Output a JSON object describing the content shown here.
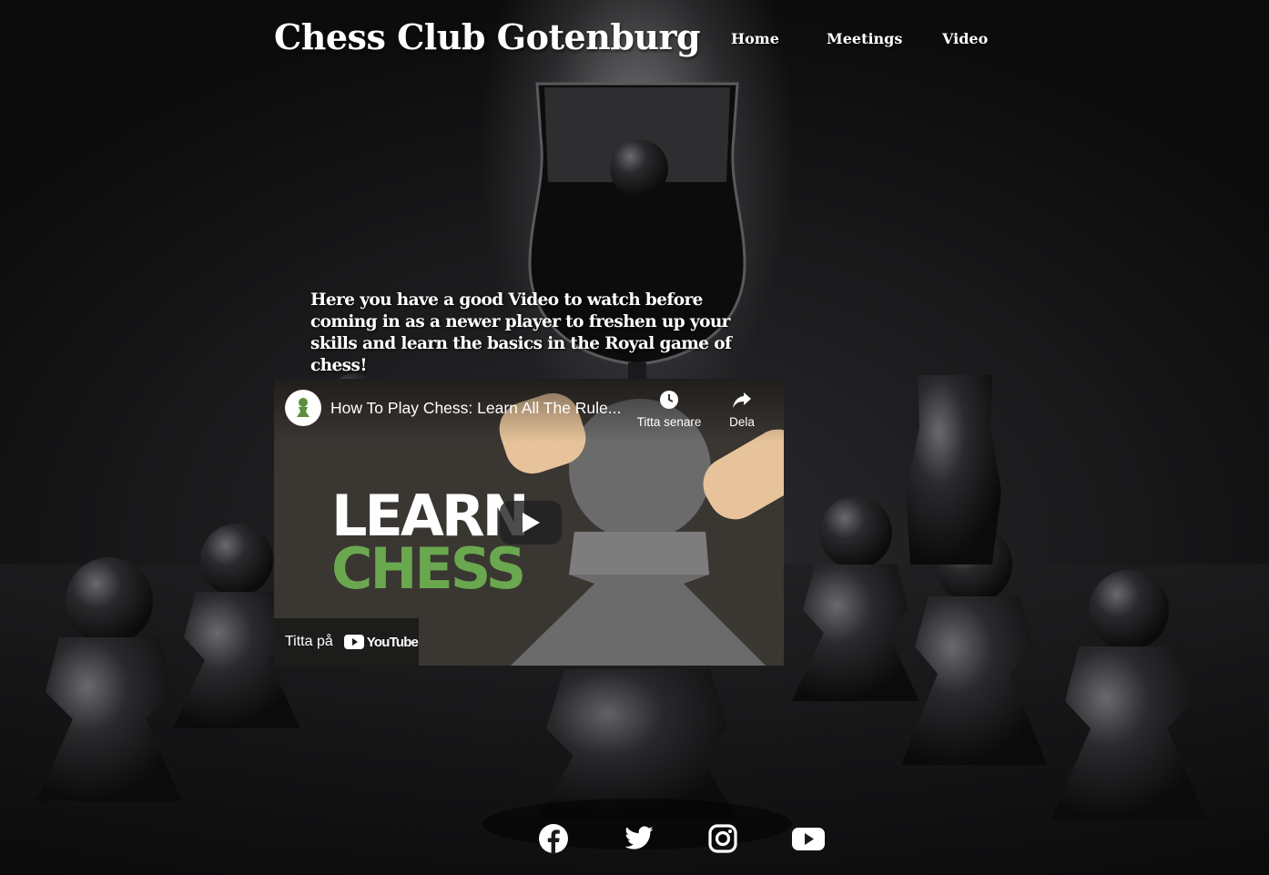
{
  "header": {
    "site_title": "Chess Club Gotenburg",
    "nav": [
      {
        "label": "Home"
      },
      {
        "label": "Meetings"
      },
      {
        "label": "Video"
      }
    ]
  },
  "main": {
    "intro_text": "Here you have a good Video to watch before coming in as a newer player to freshen up your skills and learn the basics in the Royal game of chess!",
    "video": {
      "title": "How To Play Chess: Learn All The Rule...",
      "watch_later_label": "Titta senare",
      "share_label": "Dela",
      "thumbnail_line1": "LEARN",
      "thumbnail_line2": "CHESS",
      "watch_on_label": "Titta på",
      "youtube_logo_text": "YouTube",
      "thumb_colors": {
        "accent_green": "#6aa84f",
        "hand": "#e6c39a",
        "pawn": "#6b6b6b",
        "bg": "#3a3632"
      }
    }
  },
  "footer": {
    "social": [
      {
        "icon": "facebook-icon"
      },
      {
        "icon": "twitter-icon"
      },
      {
        "icon": "instagram-icon"
      },
      {
        "icon": "youtube-icon"
      }
    ]
  }
}
